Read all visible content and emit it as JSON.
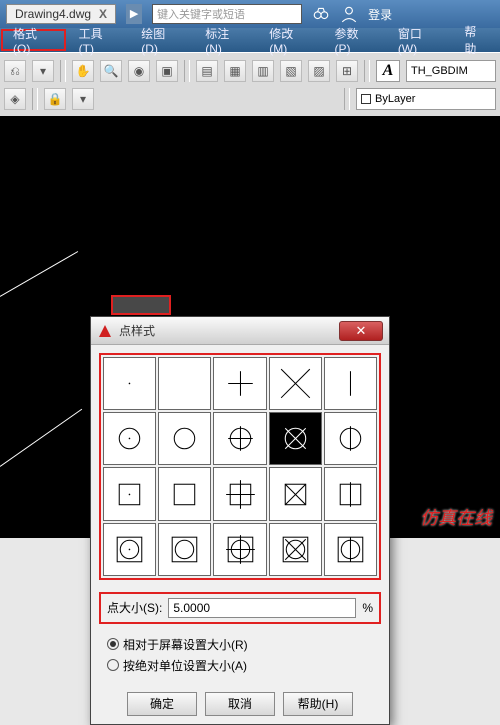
{
  "title": {
    "filename": "Drawing4.dwg",
    "close_x": "X",
    "search_placeholder": "键入关键字或短语",
    "login": "登录"
  },
  "menu": {
    "items": [
      {
        "label": "格式(O)",
        "hl": true
      },
      {
        "label": "工具(T)"
      },
      {
        "label": "绘图(D)"
      },
      {
        "label": "标注(N)"
      },
      {
        "label": "修改(M)"
      },
      {
        "label": "参数(P)"
      },
      {
        "label": "窗口(W)"
      },
      {
        "label": "帮助"
      }
    ]
  },
  "toolbar": {
    "style_combo": "TH_GBDIM",
    "layer_combo": "ByLayer"
  },
  "dialog": {
    "title": "点样式",
    "size_label": "点大小(S):",
    "size_value": "5.0000",
    "size_unit": "%",
    "radio1": "相对于屏幕设置大小(R)",
    "radio2": "按绝对单位设置大小(A)",
    "ok": "确定",
    "cancel": "取消",
    "help": "帮助(H)",
    "selected_index": 8
  },
  "watermark": "仿真在线"
}
